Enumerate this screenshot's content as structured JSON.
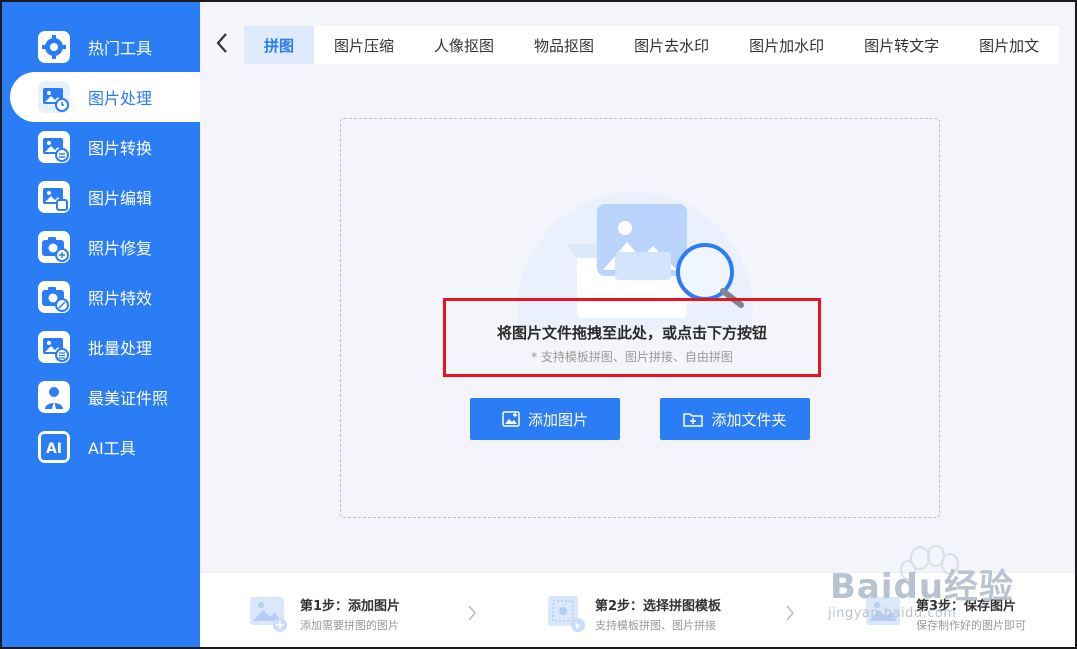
{
  "sidebar": {
    "items": [
      {
        "label": "热门工具",
        "icon": "gear-icon"
      },
      {
        "label": "图片处理",
        "icon": "image-clock-icon"
      },
      {
        "label": "图片转换",
        "icon": "image-convert-icon"
      },
      {
        "label": "图片编辑",
        "icon": "image-edit-icon"
      },
      {
        "label": "照片修复",
        "icon": "camera-plus-icon"
      },
      {
        "label": "照片特效",
        "icon": "camera-effect-icon"
      },
      {
        "label": "批量处理",
        "icon": "image-batch-icon"
      },
      {
        "label": "最美证件照",
        "icon": "id-photo-icon"
      },
      {
        "label": "AI工具",
        "icon": "ai-icon"
      }
    ],
    "active_index": 1
  },
  "tabs": [
    "拼图",
    "图片压缩",
    "人像抠图",
    "物品抠图",
    "图片去水印",
    "图片加水印",
    "图片转文字",
    "图片加文"
  ],
  "drop": {
    "title": "将图片文件拖拽至此处，或点击下方按钮",
    "subtitle": "* 支持模板拼图、图片拼接、自由拼图"
  },
  "buttons": {
    "add_image": "添加图片",
    "add_folder": "添加文件夹"
  },
  "steps": [
    {
      "title": "第1步：添加图片",
      "desc": "添加需要拼图的图片"
    },
    {
      "title": "第2步：选择拼图模板",
      "desc": "支持模板拼图、图片拼接"
    },
    {
      "title": "第3步：保存图片",
      "desc": "保存制作好的图片即可"
    }
  ],
  "watermark": {
    "text": "Baidu经验",
    "sub": "jingyan.baidu.com"
  },
  "colors": {
    "accent": "#2b7df5",
    "highlight": "#e6141e"
  }
}
